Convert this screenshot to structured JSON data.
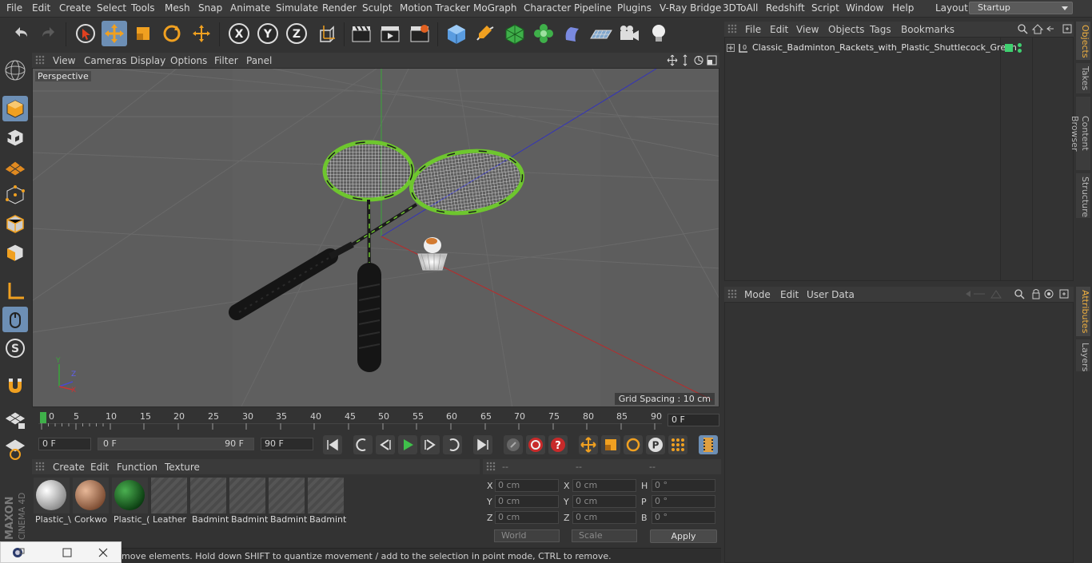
{
  "menu": [
    "File",
    "Edit",
    "Create",
    "Select",
    "Tools",
    "Mesh",
    "Snap",
    "Animate",
    "Simulate",
    "Render",
    "Sculpt",
    "Motion Tracker",
    "MoGraph",
    "Character",
    "Pipeline",
    "Plugins",
    "V-Ray Bridge",
    "3DToAll",
    "Redshift",
    "Script",
    "Window",
    "Help"
  ],
  "layout": {
    "label": "Layout:",
    "value": "Startup"
  },
  "viewport": {
    "menu": [
      "View",
      "Cameras",
      "Display",
      "Options",
      "Filter",
      "Panel"
    ],
    "label": "Perspective",
    "grid_spacing": "Grid Spacing : 10 cm"
  },
  "timeline": {
    "ticks": [
      "0",
      "5",
      "10",
      "15",
      "20",
      "25",
      "30",
      "35",
      "40",
      "45",
      "50",
      "55",
      "60",
      "65",
      "70",
      "75",
      "80",
      "85",
      "90"
    ],
    "end_field": "0 F"
  },
  "transport": {
    "start": "0 F",
    "range_left": "0 F",
    "range_right": "90 F",
    "end": "90 F"
  },
  "materials": {
    "menu": [
      "Create",
      "Edit",
      "Function",
      "Texture"
    ],
    "items": [
      "Plastic_\\",
      "Corkwo",
      "Plastic_(",
      "Leather",
      "Badmint",
      "Badmint",
      "Badmint",
      "Badmint"
    ]
  },
  "coords": {
    "headers": [
      "--",
      "--",
      "--"
    ],
    "rows": [
      {
        "l1": "X",
        "v1": "0 cm",
        "l2": "X",
        "v2": "0 cm",
        "l3": "H",
        "v3": "0 °"
      },
      {
        "l1": "Y",
        "v1": "0 cm",
        "l2": "Y",
        "v2": "0 cm",
        "l3": "P",
        "v3": "0 °"
      },
      {
        "l1": "Z",
        "v1": "0 cm",
        "l2": "Z",
        "v2": "0 cm",
        "l3": "B",
        "v3": "0 °"
      }
    ],
    "world": "World",
    "scale": "Scale",
    "apply": "Apply"
  },
  "status": "move elements. Hold down SHIFT to quantize movement / add to the selection in point mode, CTRL to remove.",
  "objects": {
    "menu": [
      "File",
      "Edit",
      "View",
      "Objects",
      "Tags",
      "Bookmarks"
    ],
    "item": "Classic_Badminton_Rackets_with_Plastic_Shuttlecock_Green"
  },
  "attributes": {
    "menu": [
      "Mode",
      "Edit",
      "User Data"
    ]
  },
  "side_tabs": [
    "Objects",
    "Takes",
    "Content Browser",
    "Structure",
    "Attributes",
    "Layers"
  ],
  "logo": {
    "line1": "MAXON",
    "line2": "CINEMA 4D"
  },
  "colors": {
    "accent": "#6d8fb5",
    "racket_green": "#6ec62e",
    "tab_active": "#f0b040"
  }
}
